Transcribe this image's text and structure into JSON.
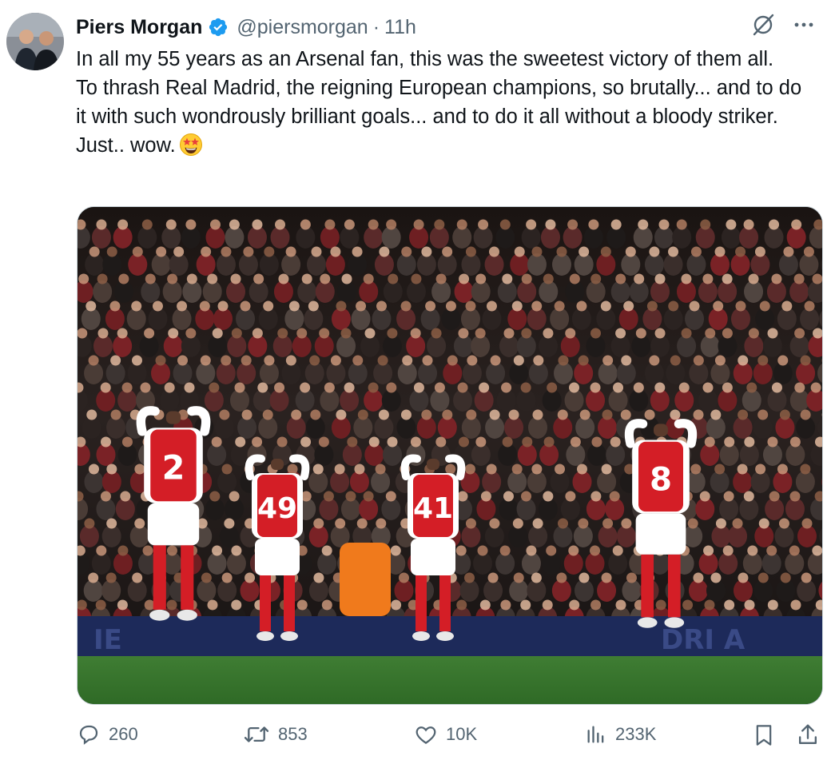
{
  "tweet": {
    "author": {
      "name": "Piers Morgan",
      "handle": "@piersmorgan",
      "verified": true,
      "avatar_icon": "profile-photo"
    },
    "time": "11h",
    "separator": "·",
    "text_lines": [
      "In all my 55 years as an Arsenal fan, this was the sweetest victory of them all.",
      "To thrash Real Madrid, the reigning European champions, so brutally... and to do it with such wondrously brilliant goals... and to do it all without a bloody striker. Just.. wow."
    ],
    "emoji_icon": "star-struck-emoji",
    "media": {
      "description_icon": "photo",
      "jersey_numbers": [
        "2",
        "49",
        "41",
        "8"
      ]
    },
    "actions": {
      "replies": "260",
      "reposts": "853",
      "likes": "10K",
      "views": "233K"
    },
    "colors": {
      "verified_blue": "#1d9bf0",
      "muted_text": "#536471",
      "arsenal_red": "#d41e26",
      "pitch_green": "#3d7a31"
    }
  }
}
